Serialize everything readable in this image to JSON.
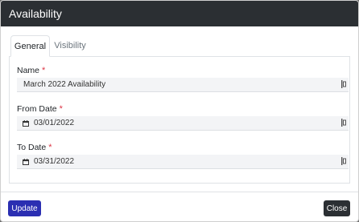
{
  "modal": {
    "title": "Availability",
    "tabs": [
      {
        "label": "General",
        "active": true
      },
      {
        "label": "Visibility",
        "active": false
      }
    ],
    "fields": {
      "name": {
        "label": "Name",
        "required_mark": "*",
        "value": "March 2022 Availability"
      },
      "from_date": {
        "label": "From Date",
        "required_mark": "*",
        "value": "03/01/2022"
      },
      "to_date": {
        "label": "To Date",
        "required_mark": "*",
        "value": "03/31/2022"
      }
    },
    "footer": {
      "update_label": "Update",
      "close_label": "Close"
    }
  },
  "colors": {
    "header_bg": "#2b2f33",
    "update_bg": "#2b2fb2",
    "required": "#dc3545",
    "field_bg": "#f3f4f6"
  },
  "icons": {
    "calendar": "calendar-icon",
    "password_manager": "password-manager-icon"
  }
}
